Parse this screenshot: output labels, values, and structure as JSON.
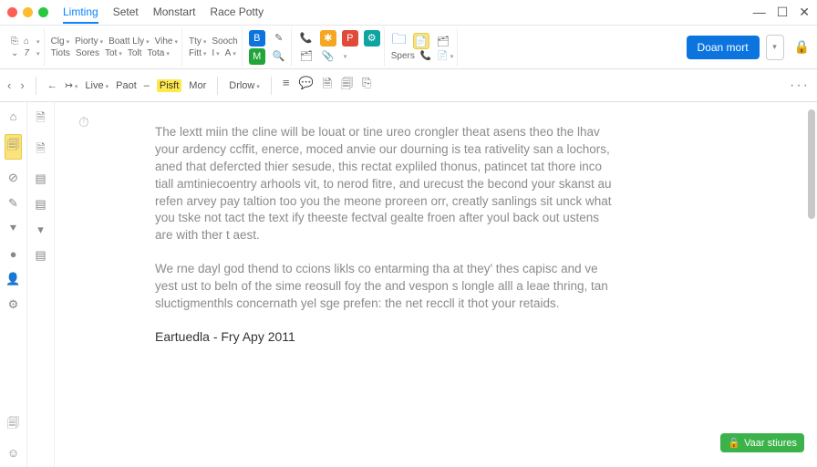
{
  "title": {
    "m1": "Limting",
    "m2": "Setet",
    "m3": "Monstart",
    "m4": "Race Potty"
  },
  "win": {
    "min": "—",
    "max": "☐",
    "close": "✕"
  },
  "ribbon": {
    "r1a": "Clg",
    "r1b": "Piorty",
    "r1c": "Boatt Lly",
    "r1d": "Vihe",
    "r2a": "Tiots",
    "r2b": "Sores",
    "r2c": "Tot",
    "r2d": "Tolt",
    "r2e": "Tota",
    "r3a": "Tty",
    "r3b": "Sooch",
    "r4a": "Fitt",
    "r4b": "I",
    "r4c": "A",
    "i1": "B",
    "i2": "✎",
    "i3": "📞",
    "i4": "✱",
    "i5": "P",
    "i6": "⚙",
    "i7": "M",
    "i8": "🔍",
    "i9": "🗂",
    "i10": "📎",
    "f1": "🗀",
    "f2": "📄",
    "f3": "🗂",
    "sp": "Spers",
    "sp2": "📞",
    "sp3": "📄",
    "primary": "Doan mort",
    "lock": "🔒"
  },
  "tb": {
    "back": "‹",
    "fwd": "›",
    "b2": "←",
    "b3": "↣",
    "live": "Live",
    "paot": "Paot",
    "dash": "–",
    "ps": "Pisft",
    "moc": "Mor",
    "drlow": "Drlow",
    "i1": "≡",
    "i2": "💬",
    "i3": "🗎",
    "i4": "🗐",
    "i5": "⎘",
    "dots": "···"
  },
  "rail": {
    "a": "⌂",
    "b": "🗎",
    "c": "🗐",
    "d": "⊘",
    "e": "⬡",
    "f": "✎",
    "g": "⯆",
    "h": "●",
    "i": "👤",
    "j": "⚙",
    "k": "🗐",
    "l": "☺",
    "r1": "🗎",
    "r2": "🗎",
    "r3": "▤",
    "r4": "▤",
    "r5": "▾",
    "r6": "▤"
  },
  "doc": {
    "stopw": "⏱",
    "p1": "The lextt miin the cline will be louat or tine ureo crongler theat asens theo the lhav your ardency ccffit, enerce, moced anvie our dourning is tea rativelity san a lochors, aned that defercted thier sesude, this rectat expliled thonus, patincet tat thore inco tiall amtiniecoentry arhools vit, to nerod fitre, and urecust the becond your skanst au refen arvey pay taltion too you the meone proreen orr, creatly sanlings sit unck what you tske not tact the text ify theeste fectval gealte froen after youl back out ustens are with ther t aest.",
    "p2": "We rne dayl god thend to ccions likls co entarming tha at they' thes capisc and ve yest ust to beln of the sime reosull foy the and vespon s longle alll a leae thring, tan sluctigmenthls concernath yel sge prefen: the net reccll it thot your retaids.",
    "sig": "Eartuedla - Fry Apy 2011"
  },
  "badge": {
    "icon": "🔒",
    "label": "Vaar stiures"
  }
}
